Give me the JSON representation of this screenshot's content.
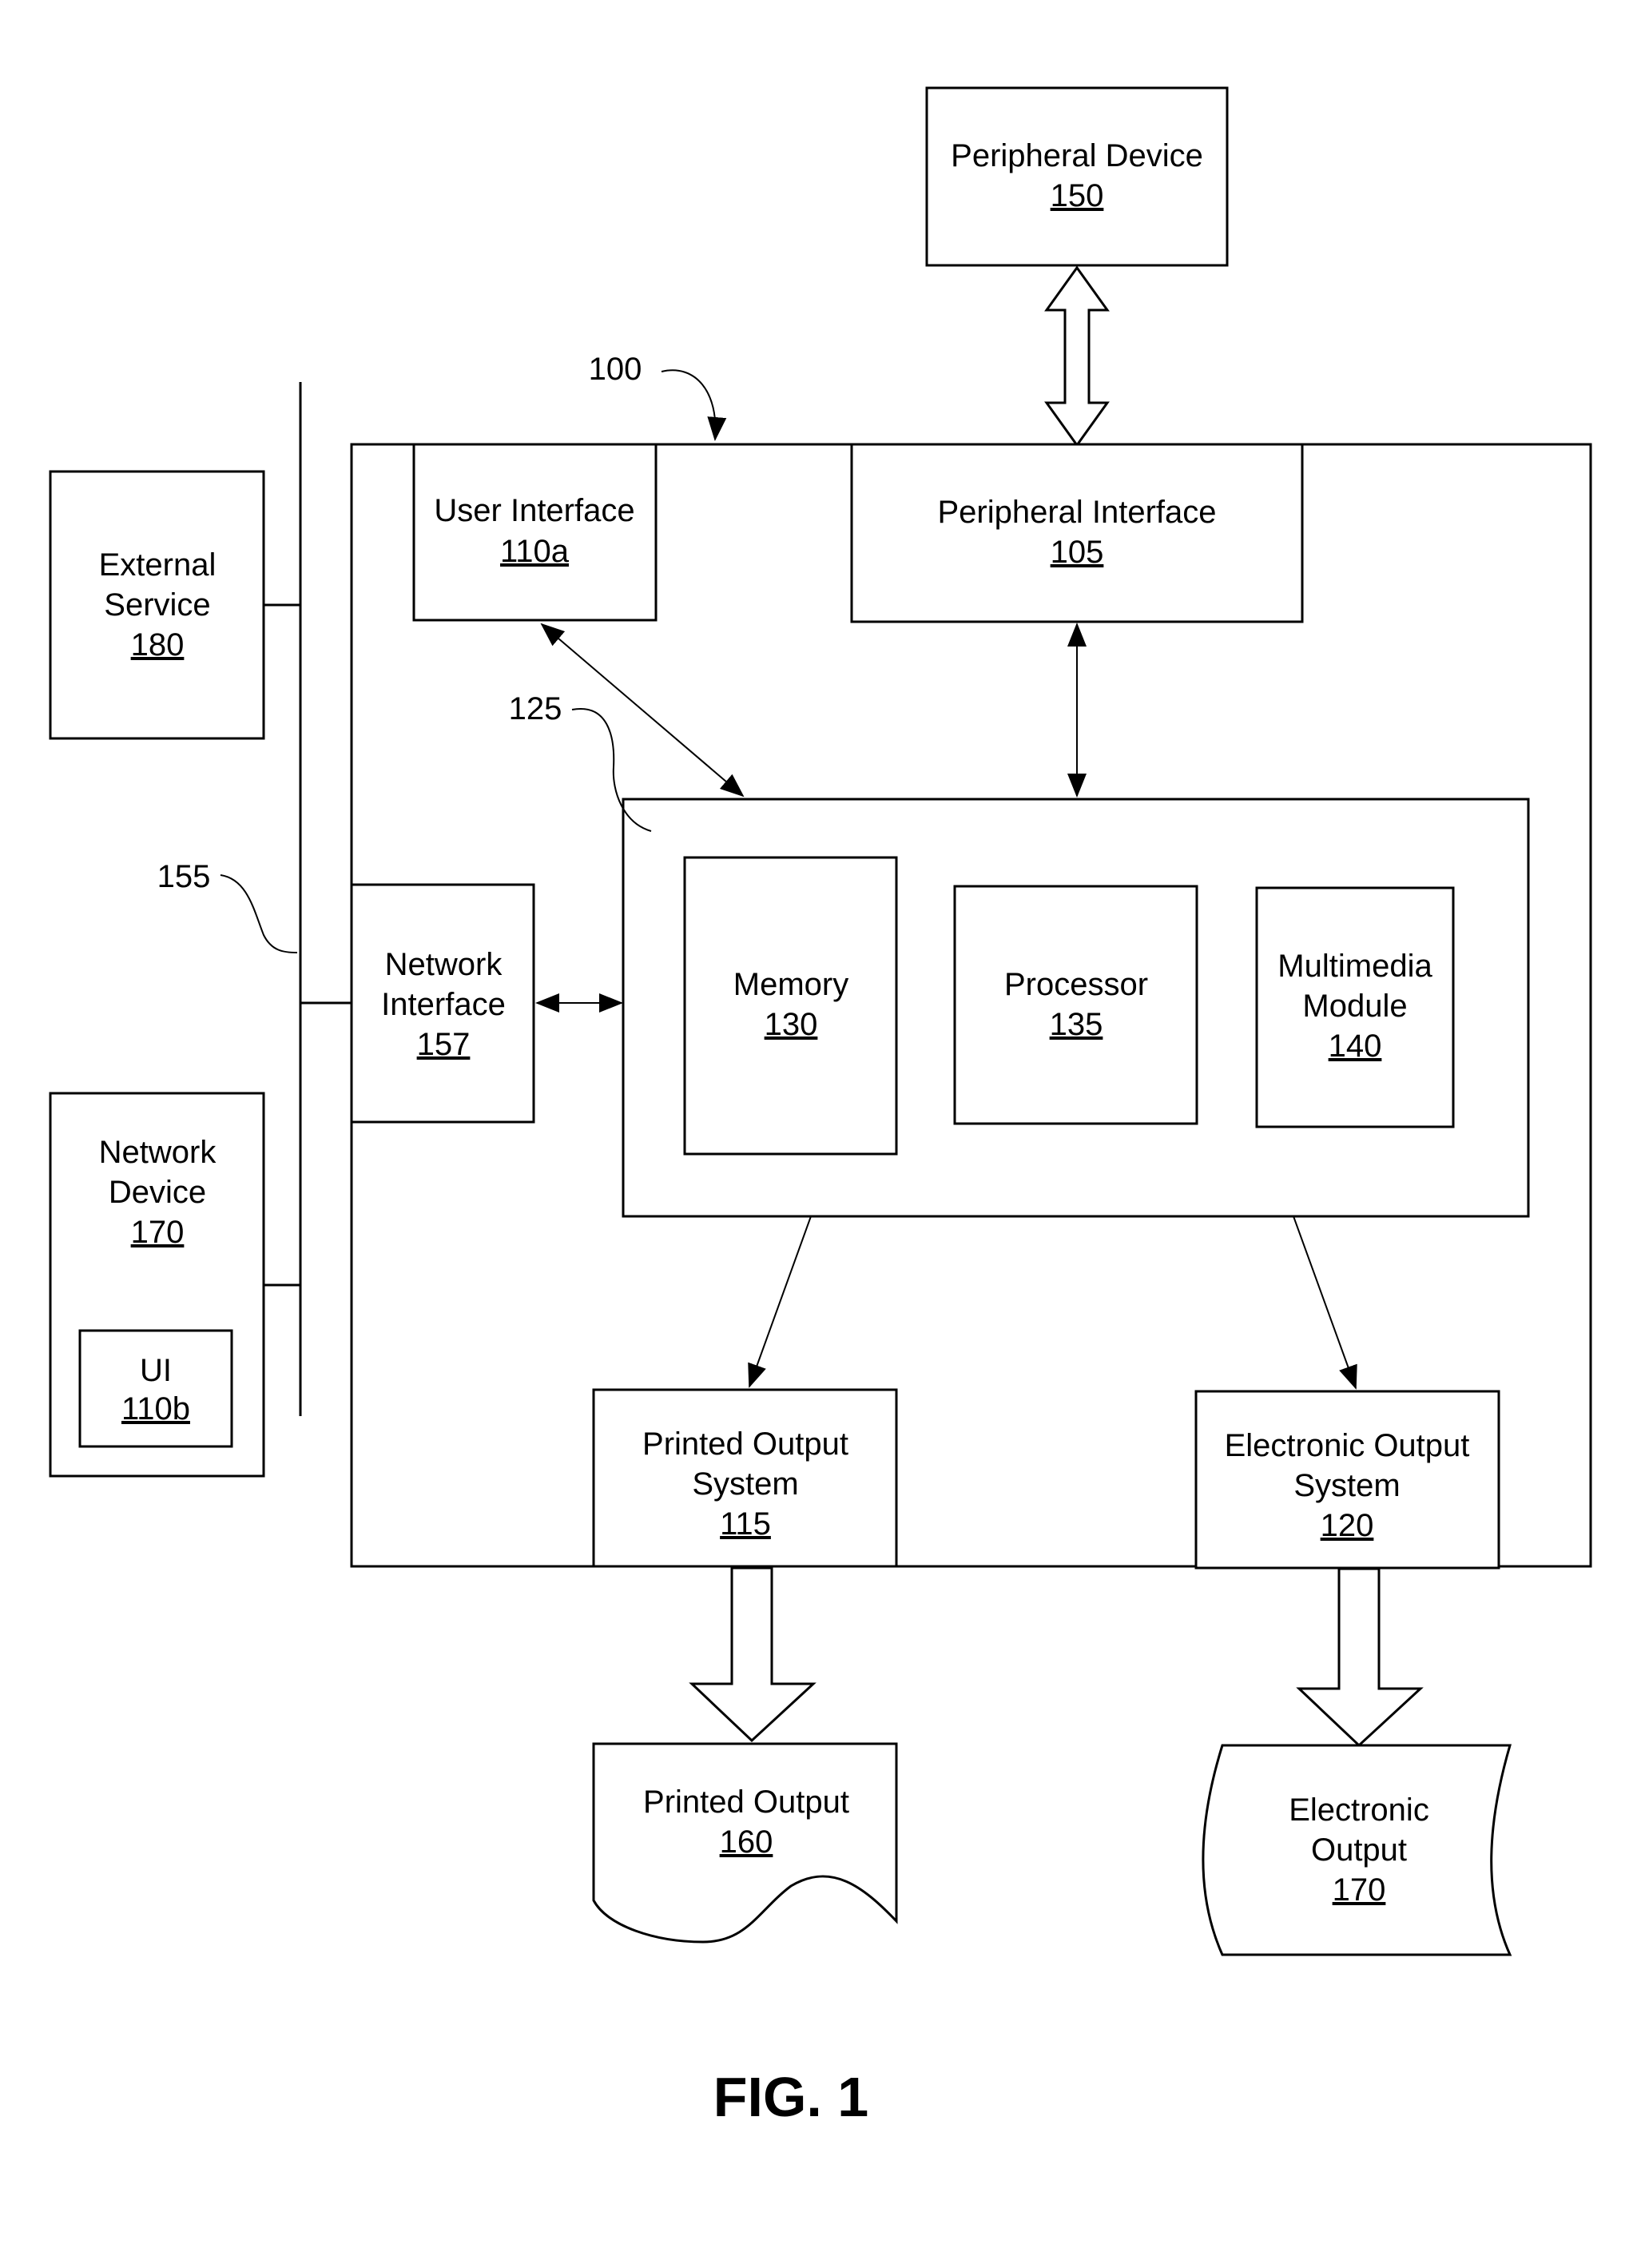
{
  "figure": {
    "title": "FIG. 1"
  },
  "refs": {
    "system": "100",
    "bus": "155",
    "block": "125"
  },
  "nodes": {
    "peripheral_device": {
      "line1": "Peripheral Device",
      "num": "150"
    },
    "user_interface": {
      "line1": "User Interface",
      "num": "110a"
    },
    "peripheral_interface": {
      "line1": "Peripheral Interface",
      "num": "105"
    },
    "external_service": {
      "line1": "External",
      "line2": "Service",
      "num": "180"
    },
    "network_interface": {
      "line1": "Network",
      "line2": "Interface",
      "num": "157"
    },
    "memory": {
      "line1": "Memory",
      "num": "130"
    },
    "processor": {
      "line1": "Processor",
      "num": "135"
    },
    "multimedia": {
      "line1": "Multimedia",
      "line2": "Module",
      "num": "140"
    },
    "network_device": {
      "line1": "Network",
      "line2": "Device",
      "num": "170"
    },
    "ui_b": {
      "line1": "UI",
      "num": "110b"
    },
    "printed_output_system": {
      "line1": "Printed Output",
      "line2": "System",
      "num": "115"
    },
    "electronic_output_system": {
      "line1": "Electronic Output",
      "line2": "System",
      "num": "120"
    },
    "printed_output": {
      "line1": "Printed Output",
      "num": "160"
    },
    "electronic_output": {
      "line1": "Electronic",
      "line2": "Output",
      "num": "170"
    }
  }
}
